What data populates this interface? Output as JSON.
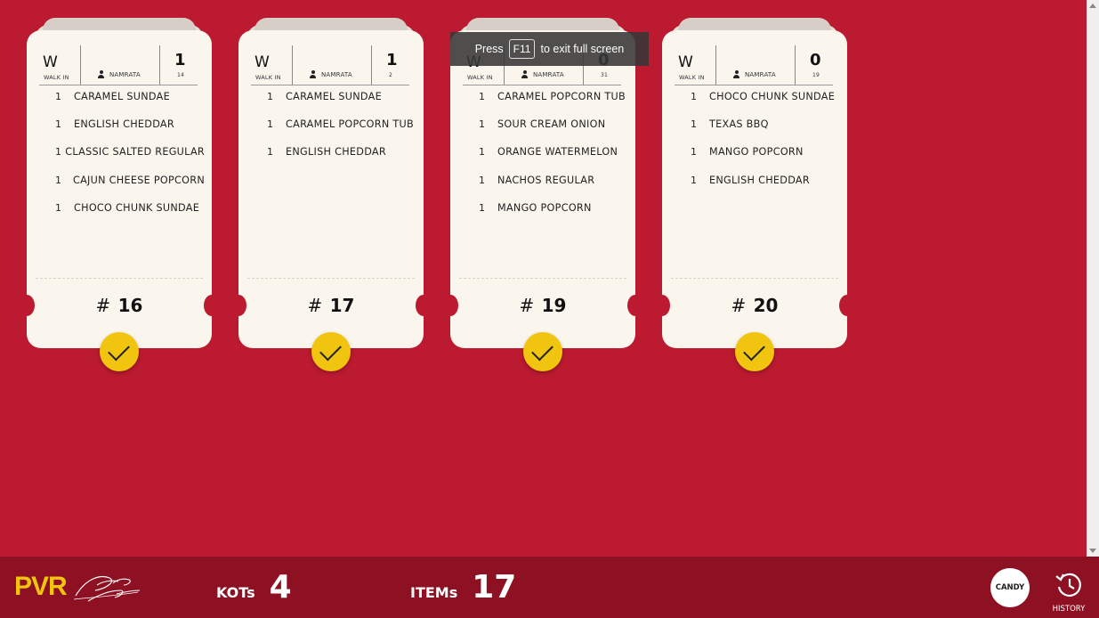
{
  "fullscreen_toast": {
    "press": "Press",
    "key": "F11",
    "suffix": "to exit full screen"
  },
  "tickets": [
    {
      "mode_letter": "W",
      "mode_label": "WALK IN",
      "user": "NAMRATA",
      "count": "1",
      "count_sub": "14",
      "kot": "16",
      "items": [
        {
          "qty": "1",
          "name": "CARAMEL SUNDAE"
        },
        {
          "qty": "1",
          "name": "ENGLISH CHEDDAR"
        },
        {
          "qty": "1",
          "name": "CLASSIC SALTED REGULAR"
        },
        {
          "qty": "1",
          "name": "CAJUN CHEESE POPCORN"
        },
        {
          "qty": "1",
          "name": "CHOCO CHUNK SUNDAE"
        }
      ]
    },
    {
      "mode_letter": "W",
      "mode_label": "WALK IN",
      "user": "NAMRATA",
      "count": "1",
      "count_sub": "2",
      "kot": "17",
      "items": [
        {
          "qty": "1",
          "name": "CARAMEL SUNDAE"
        },
        {
          "qty": "1",
          "name": "CARAMEL POPCORN TUB"
        },
        {
          "qty": "1",
          "name": "ENGLISH CHEDDAR"
        }
      ]
    },
    {
      "mode_letter": "W",
      "mode_label": "WALK IN",
      "user": "NAMRATA",
      "count": "0",
      "count_sub": "31",
      "kot": "19",
      "items": [
        {
          "qty": "1",
          "name": "CARAMEL POPCORN TUB"
        },
        {
          "qty": "1",
          "name": "SOUR CREAM ONION"
        },
        {
          "qty": "1",
          "name": "ORANGE WATERMELON"
        },
        {
          "qty": "1",
          "name": "NACHOS REGULAR"
        },
        {
          "qty": "1",
          "name": "MANGO POPCORN"
        }
      ]
    },
    {
      "mode_letter": "W",
      "mode_label": "WALK IN",
      "user": "NAMRATA",
      "count": "0",
      "count_sub": "19",
      "kot": "20",
      "items": [
        {
          "qty": "1",
          "name": "CHOCO CHUNK SUNDAE"
        },
        {
          "qty": "1",
          "name": "TEXAS BBQ"
        },
        {
          "qty": "1",
          "name": "MANGO POPCORN"
        },
        {
          "qty": "1",
          "name": "ENGLISH CHEDDAR"
        }
      ]
    }
  ],
  "footer": {
    "brand": "PVR",
    "brand_script": "Director's Cut",
    "kots_label": "KOTs",
    "kots_value": "4",
    "items_label": "ITEMs",
    "items_value": "17",
    "candy_label": "CANDY",
    "history_label": "HISTORY"
  },
  "colors": {
    "background": "#bb1a30",
    "footer": "#8d1123",
    "card": "#faf6ee",
    "accent_yellow": "#f1c40f"
  }
}
